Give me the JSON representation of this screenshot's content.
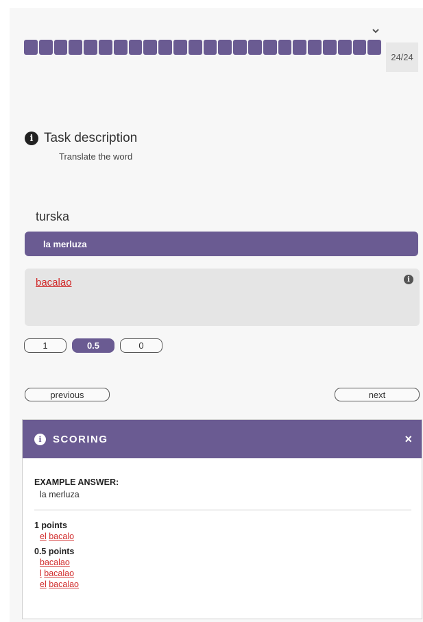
{
  "progress": {
    "segments": 24,
    "counter": "24/24"
  },
  "task": {
    "title": "Task description",
    "description": "Translate the word"
  },
  "question": {
    "word": "turska",
    "correct_answer": "la merluza",
    "user_answer": "bacalao"
  },
  "scores": [
    "1",
    "0.5",
    "0"
  ],
  "selected_score": "0.5",
  "nav": {
    "previous": "previous",
    "next": "next"
  },
  "scoring": {
    "title": "SCORING",
    "close": "×",
    "example_label": "EXAMPLE ANSWER:",
    "example_value": "la merluza",
    "groups": [
      {
        "label": "1 points",
        "items": [
          [
            "el",
            "bacalo"
          ]
        ]
      },
      {
        "label": "0.5 points",
        "items": [
          [
            "bacalao"
          ],
          [
            "l",
            "bacalao"
          ],
          [
            "el",
            "bacalao"
          ]
        ]
      }
    ]
  },
  "colors": {
    "accent": "#6a5b92",
    "error": "#d12b2b"
  },
  "icons": {
    "info": "info-circle-icon",
    "chevron": "chevron-down-icon",
    "close": "close-icon"
  }
}
